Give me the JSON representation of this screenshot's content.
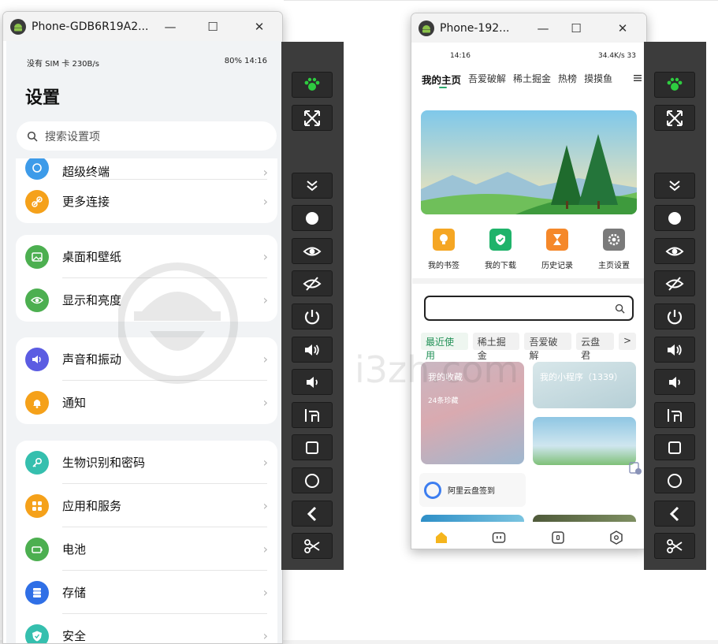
{
  "left_window": {
    "title": "Phone-GDB6R19A2...",
    "status": {
      "left": "没有 SIM 卡 230B/s",
      "right": "80% 14:16"
    },
    "heading": "设置",
    "search_placeholder": "搜索设置项",
    "cards": [
      {
        "items": [
          {
            "label": "超级终端",
            "icon": "super-device-icon",
            "color": "#3d9be9"
          },
          {
            "label": "更多连接",
            "icon": "link-icon",
            "color": "#f5a11a"
          }
        ]
      },
      {
        "items": [
          {
            "label": "桌面和壁纸",
            "icon": "wallpaper-icon",
            "color": "#4caf50"
          },
          {
            "label": "显示和亮度",
            "icon": "eye-icon",
            "color": "#4caf50"
          }
        ]
      },
      {
        "items": [
          {
            "label": "声音和振动",
            "icon": "speaker-icon",
            "color": "#5b5ce2"
          },
          {
            "label": "通知",
            "icon": "bell-icon",
            "color": "#f5a11a"
          }
        ]
      },
      {
        "items": [
          {
            "label": "生物识别和密码",
            "icon": "key-icon",
            "color": "#35bfae"
          },
          {
            "label": "应用和服务",
            "icon": "apps-icon",
            "color": "#f5a11a"
          },
          {
            "label": "电池",
            "icon": "battery-icon",
            "color": "#4caf50"
          },
          {
            "label": "存储",
            "icon": "storage-icon",
            "color": "#2f6fe6"
          },
          {
            "label": "安全",
            "icon": "shield-icon",
            "color": "#35bfae"
          }
        ]
      }
    ]
  },
  "right_window": {
    "title": "Phone-192...",
    "status": {
      "time": "14:16",
      "right": "34.4K/s 33"
    },
    "tabs": [
      "我的主页",
      "吾爱破解",
      "稀土掘金",
      "热榜",
      "摸摸鱼"
    ],
    "quick_items": [
      {
        "label": "我的书签",
        "icon": "bulb-icon",
        "color": "#f5a623"
      },
      {
        "label": "我的下载",
        "icon": "download-check-icon",
        "color": "#1fb36a"
      },
      {
        "label": "历史记录",
        "icon": "hourglass-icon",
        "color": "#f5882a"
      },
      {
        "label": "主页设置",
        "icon": "gear-icon",
        "color": "#7a7a7a"
      }
    ],
    "chips": [
      "最近使用",
      "稀土掘金",
      "吾爱破解",
      "云盘君",
      ">"
    ],
    "favorites": {
      "title": "我的收藏",
      "count": "24条珍藏"
    },
    "miniapps": {
      "title": "我的小程序（1339）"
    },
    "signin_label": "阿里云盘签到"
  },
  "watermark": "i3zh.com",
  "colors": {
    "sidebar_bg": "#3c3c3c",
    "button_bg": "#2b2b2b",
    "accent_green": "#2aa86c"
  }
}
